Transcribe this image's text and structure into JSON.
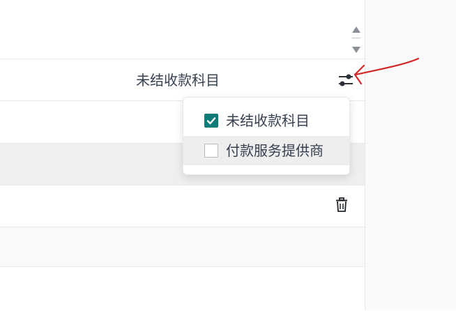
{
  "table": {
    "column_header": "未结收款科目"
  },
  "column_menu": {
    "options": [
      {
        "label": "未结收款科目",
        "checked": true
      },
      {
        "label": "付款服务提供商",
        "checked": false
      }
    ]
  },
  "colors": {
    "checkbox_accent": "#0e7d7a",
    "annotation_arrow": "#d42626",
    "hover_row": "#efefef"
  },
  "icons": {
    "settings": "sliders-icon",
    "delete": "trash-icon",
    "sort": "sort-arrows-icon",
    "annotation": "red-arrow-annotation"
  }
}
